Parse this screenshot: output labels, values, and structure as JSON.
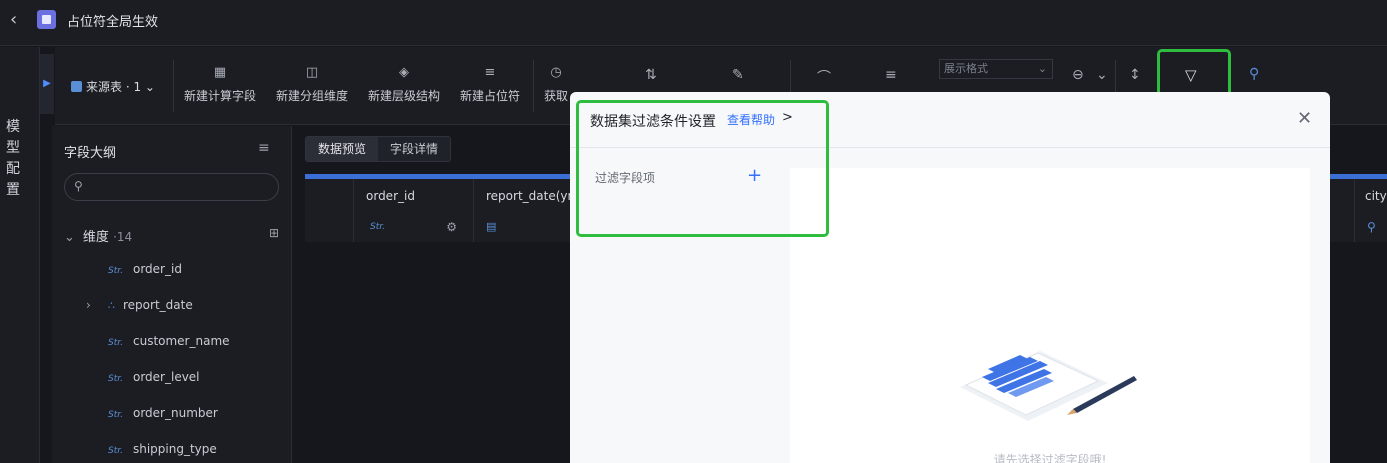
{
  "header": {
    "title": "占位符全局生效",
    "back_icon": "chevron-left-icon"
  },
  "sidebar": {
    "model_tab_chars": [
      "模",
      "型",
      "配",
      "置"
    ]
  },
  "toolbar": {
    "source_label": "来源表 · 1",
    "buttons": [
      {
        "label": "新建计算字段",
        "icon": "calculator-icon"
      },
      {
        "label": "新建分组维度",
        "icon": "group-icon"
      },
      {
        "label": "新建层级结构",
        "icon": "layers-icon"
      },
      {
        "label": "新建占位符",
        "icon": "placeholder-icon"
      },
      {
        "label": "获取",
        "icon": "fetch-icon"
      }
    ],
    "format_select": "展示格式"
  },
  "outline": {
    "title": "字段大纲",
    "dimension_label": "维度",
    "dimension_count": "·14",
    "fields": [
      {
        "type": "Str.",
        "name": "order_id"
      },
      {
        "type": "hier",
        "name": "report_date"
      },
      {
        "type": "Str.",
        "name": "customer_name"
      },
      {
        "type": "Str.",
        "name": "order_level"
      },
      {
        "type": "Str.",
        "name": "order_number"
      },
      {
        "type": "Str.",
        "name": "shipping_type"
      }
    ]
  },
  "main": {
    "tabs": [
      {
        "label": "数据预览"
      },
      {
        "label": "字段详情"
      }
    ],
    "columns": [
      {
        "name": "order_id",
        "type": "Str."
      },
      {
        "name": "report_date(ymd",
        "type": "date"
      },
      {
        "name": "city",
        "type": "geo"
      }
    ]
  },
  "dialog": {
    "title": "数据集过滤条件设置",
    "help_link": "查看帮助",
    "help_arrow": ">",
    "filter_field_label": "过滤字段项",
    "add": "+",
    "empty_hint": "请先选择过滤字段哦!"
  },
  "colors": {
    "accent": "#3370ff",
    "highlight": "#2ebd3f",
    "bg": "#15171c"
  }
}
